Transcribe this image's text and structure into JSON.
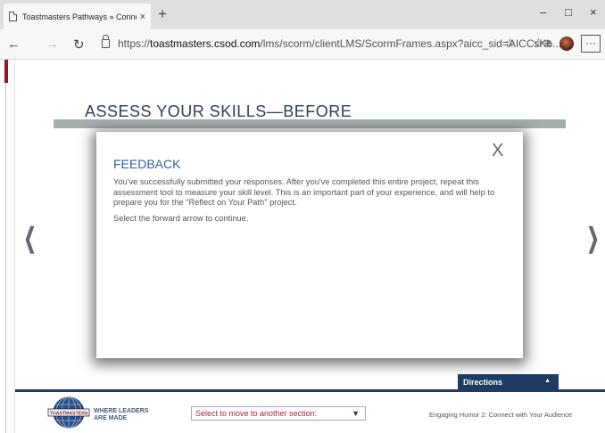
{
  "browser": {
    "tab_title": "Toastmasters Pathways » Conne",
    "tab_close": "×",
    "new_tab": "+",
    "minimize": "–",
    "maximize": "□",
    "close": "×",
    "back": "←",
    "forward": "→",
    "refresh": "↻",
    "url_prefix": "https://",
    "url_host": "toastmasters.csod.com",
    "url_path": "/lms/scorm/clientLMS/ScormFrames.aspx?aicc_sid=AICCsKb...",
    "favorite": "☆",
    "favorites_list": "☆≡",
    "more": "···"
  },
  "page": {
    "heading": "ASSESS YOUR SKILLS—BEFORE",
    "prev_arrow": "❮",
    "next_arrow": "❯"
  },
  "modal": {
    "close": "X",
    "title": "FEEDBACK",
    "paragraph1": "You've successfully submitted your responses. After you've completed this entire project, repeat this assessment tool to measure your skill level. This is an important part of your experience, and will help to prepare you for the \"Reflect on Your Path\" project.",
    "paragraph2": "Select the forward arrow to continue."
  },
  "footer": {
    "directions_label": "Directions",
    "directions_caret": "▲",
    "logo_text": "TOASTMASTERS",
    "tagline_line1": "WHERE LEADERS",
    "tagline_line2": "ARE MADE",
    "section_select": "Select to move to another section:",
    "section_caret": "▼",
    "course_name": "Engaging Humor 2: Connect with Your Audience"
  },
  "colors": {
    "navy": "#1f3a63",
    "heading": "#2d3f5c",
    "feedback_title": "#2f5fa4",
    "select_text": "#b0223a"
  }
}
